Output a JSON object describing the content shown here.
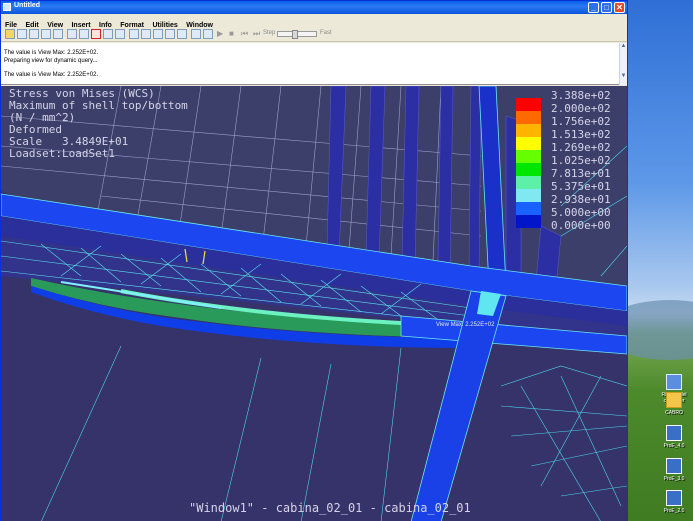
{
  "window": {
    "title": "Untitled",
    "controls": {
      "minimize": "_",
      "maximize": "□",
      "close": "✕"
    }
  },
  "menu": [
    "File",
    "Edit",
    "View",
    "Insert",
    "Info",
    "Format",
    "Utilities",
    "Window"
  ],
  "toolbar": {
    "step_label": "Step",
    "fast_label": "Fast"
  },
  "messages": [
    "The value is View Max:  2.252E+02.",
    "Preparing view for dynamic query...",
    "The value is View Max:  2.252E+02."
  ],
  "viewport": {
    "legend_title_lines": [
      "Stress von Mises (WCS)",
      "Maximum of shell top/bottom",
      "(N / mm^2)",
      "Deformed",
      "Scale   3.4849E+01",
      "Loadset:LoadSet1"
    ],
    "legend": [
      {
        "value": "3.388e+02",
        "color": ""
      },
      {
        "value": "2.000e+02",
        "color": "#ff0000"
      },
      {
        "value": "1.756e+02",
        "color": "#ff6a00"
      },
      {
        "value": "1.513e+02",
        "color": "#ffb400"
      },
      {
        "value": "1.269e+02",
        "color": "#ffff00"
      },
      {
        "value": "1.025e+02",
        "color": "#66ff00"
      },
      {
        "value": "7.813e+01",
        "color": "#00e600"
      },
      {
        "value": "5.375e+01",
        "color": "#5cf0a8"
      },
      {
        "value": "2.938e+01",
        "color": "#7fe8f0"
      },
      {
        "value": "5.000e+00",
        "color": "#1a62ff"
      },
      {
        "value": "0.000e+00",
        "color": "#0016c8"
      }
    ],
    "hover_value": "View Max: 2.252E+02",
    "footer_title": "\"Window1\" - cabina_02_01 - cabina_02_01"
  },
  "desktop_icons": [
    {
      "label": "Risorse del computer",
      "color": "#5b8de0"
    },
    {
      "label": "CABRO",
      "color": "#f2c64a"
    },
    {
      "label": "ProE_4.0",
      "color": "#3a6fc8"
    },
    {
      "label": "ProE_3.0",
      "color": "#3a6fc8"
    },
    {
      "label": "ProE_2.0",
      "color": "#3a6fc8"
    }
  ]
}
